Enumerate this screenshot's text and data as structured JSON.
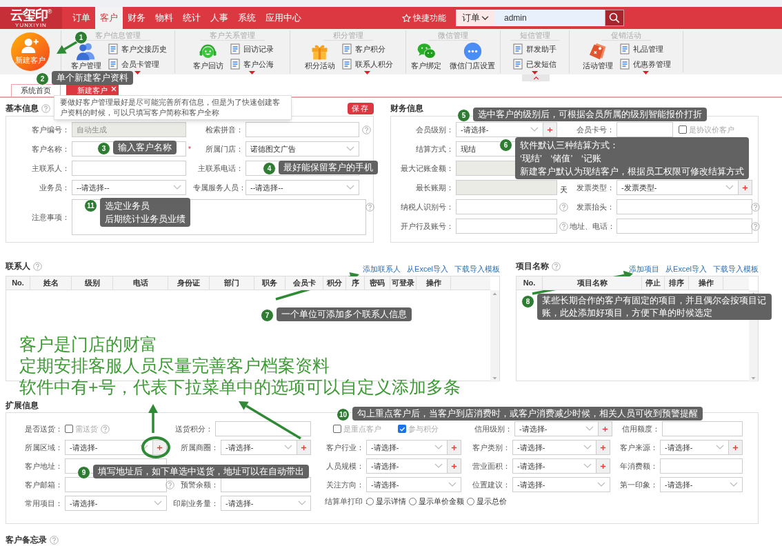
{
  "logo": {
    "name": "云玺印",
    "mark": "®",
    "subtitle": "YUNXIYIN"
  },
  "menu": [
    {
      "label": "订单",
      "selected": false
    },
    {
      "label": "客户",
      "selected": true
    },
    {
      "label": "财务",
      "selected": false
    },
    {
      "label": "物料",
      "selected": false
    },
    {
      "label": "统计",
      "selected": false
    },
    {
      "label": "人事",
      "selected": false
    },
    {
      "label": "系统",
      "selected": false
    },
    {
      "label": "应用中心",
      "selected": false
    }
  ],
  "quick_functions": "快捷功能",
  "search": {
    "scope": "订单",
    "value": "admin"
  },
  "ribbon": {
    "new_customer": "新建客户",
    "groups": [
      {
        "title": "客户信息管理",
        "big": [
          "客户管理"
        ],
        "items": [
          "客户交接历史",
          "会员卡管理"
        ],
        "more": true
      },
      {
        "title": "客户关系管理",
        "big": [
          "客户回访"
        ],
        "items": [
          "回访记录",
          "客户公海"
        ],
        "more": true
      },
      {
        "title": "积分管理",
        "big": [
          "积分活动"
        ],
        "items": [
          "客户积分",
          "联系人积分"
        ],
        "more": true
      },
      {
        "title": "微信管理",
        "big": [
          "客户绑定",
          "微信门店设置"
        ],
        "more": false
      },
      {
        "title": "短信管理",
        "items": [
          "群发助手",
          "已发短信"
        ],
        "more": true
      },
      {
        "title": "促销活动",
        "big": [
          "活动管理"
        ],
        "items": [
          "礼品管理",
          "优惠券管理"
        ],
        "more": true
      }
    ]
  },
  "tabs": [
    {
      "label": "系统首页",
      "selected": false,
      "closable": false
    },
    {
      "label": "新建客户",
      "selected": true,
      "closable": true
    }
  ],
  "tooltip": "要做好客户管理最好是尽可能完善所有信息，但是为了快速创建客户资料的时候，可以只填写客户简称和客户全称",
  "basic": {
    "title": "基本信息",
    "save": "保存",
    "rows": [
      [
        {
          "kind": "input",
          "label": "客户编号：",
          "placeholder": "自动生成",
          "disabled": true
        },
        {
          "kind": "input",
          "label": "检索拼音：",
          "help": true
        }
      ],
      [
        {
          "kind": "input",
          "label": "客户名称：",
          "required_mark": "*"
        },
        {
          "kind": "select",
          "label": "所属门店：",
          "value": "诺德图文广告"
        }
      ],
      [
        {
          "kind": "input",
          "label": "主联系人："
        },
        {
          "kind": "input",
          "label": "主联系电话："
        }
      ],
      [
        {
          "kind": "select",
          "label": "业务员：",
          "value": "--请选择--"
        },
        {
          "kind": "select",
          "label": "专属服务人员：",
          "value": "--请选择--"
        }
      ],
      [
        {
          "kind": "textarea",
          "label": "注意事项：",
          "help": true
        }
      ]
    ]
  },
  "finance": {
    "title": "财务信息",
    "rows": [
      [
        {
          "kind": "select",
          "label": "会员级别：",
          "value": "-请选择-",
          "plus": true
        },
        {
          "kind": "input",
          "label": "会员卡号："
        },
        {
          "kind": "checkbox",
          "text": "是协议价客户",
          "checked": false
        }
      ],
      [
        {
          "kind": "select",
          "label": "结算方式：",
          "value": "现结"
        }
      ],
      [
        {
          "kind": "input",
          "label": "最大记账金额：",
          "disabled": true
        }
      ],
      [
        {
          "kind": "input",
          "label": "最长账期：",
          "disabled": true,
          "suffix": "天"
        },
        {
          "kind": "select",
          "label": "发票类型：",
          "value": "-发票类型-",
          "plus": true
        }
      ],
      [
        {
          "kind": "input",
          "label": "纳税人识别号：",
          "help": true
        },
        {
          "kind": "input",
          "label": "发票抬头：",
          "help": true
        }
      ],
      [
        {
          "kind": "input",
          "label": "开户行及账号：",
          "help": true
        },
        {
          "kind": "input",
          "label": "地址、电话：",
          "help": true
        }
      ]
    ]
  },
  "contacts": {
    "title": "联系人",
    "links": [
      "添加联系人",
      "从Excel导入",
      "下载导入模板"
    ],
    "columns": [
      "No.",
      "姓名",
      "级别",
      "电话",
      "身份证",
      "部门",
      "职务",
      "会员卡",
      "积分",
      "序",
      "密码",
      "可登录",
      "操作"
    ]
  },
  "projects": {
    "title": "项目名称",
    "links": [
      "添加项目",
      "从Excel导入",
      "下载导入模板"
    ],
    "columns": [
      "No.",
      "项目名称",
      "停止",
      "排序",
      "操作"
    ]
  },
  "extended": {
    "title": "扩展信息",
    "left_rows": [
      [
        {
          "kind": "checkbox",
          "label": "是否送货：",
          "text": "需送货",
          "checked": false,
          "help": true
        },
        {
          "kind": "input",
          "label": "送货积分："
        }
      ],
      [
        {
          "kind": "select",
          "label": "所属区域：",
          "value": "-请选择-",
          "plus": true
        },
        {
          "kind": "select",
          "label": "所属商圈：",
          "value": "-请选择-",
          "plus": true
        }
      ],
      [
        {
          "kind": "input",
          "label": "客户地址："
        }
      ],
      [
        {
          "kind": "input",
          "label": "客户邮箱：",
          "help": true
        },
        {
          "kind": "input",
          "label": "预警余额："
        }
      ],
      [
        {
          "kind": "select",
          "label": "常用项目：",
          "value": "-请选择-"
        },
        {
          "kind": "select",
          "label": "印刷业务量：",
          "value": "-请选择-"
        }
      ]
    ],
    "right_rows": [
      [
        {
          "kind": "checks",
          "items": [
            {
              "text": "是重点客户",
              "checked": false
            },
            {
              "text": "参与积分",
              "checked": true
            }
          ]
        },
        {
          "kind": "select",
          "label": "信用级别：",
          "value": "-请选择-",
          "plus": true
        },
        {
          "kind": "input",
          "label": "信用额度："
        }
      ],
      [
        {
          "kind": "select",
          "label": "客户行业：",
          "value": "-请选择-",
          "plus": true
        },
        {
          "kind": "select",
          "label": "客户类别：",
          "value": "-请选择-",
          "plus": true
        },
        {
          "kind": "select",
          "label": "客户来源：",
          "value": "-请选择-",
          "plus": true
        }
      ],
      [
        {
          "kind": "select",
          "label": "人员规模：",
          "value": "-请选择-",
          "plus": true
        },
        {
          "kind": "select",
          "label": "营业面积：",
          "value": "-请选择-",
          "plus": true
        },
        {
          "kind": "input",
          "label": "年消费额："
        }
      ],
      [
        {
          "kind": "select",
          "label": "关注方向：",
          "value": "-请选择-"
        },
        {
          "kind": "select",
          "label": "位置建议：",
          "value": "-请选择-"
        },
        {
          "kind": "select",
          "label": "第一印象：",
          "value": "-请选择-"
        }
      ],
      [
        {
          "kind": "radios",
          "label": "结算单打印：",
          "options": [
            {
              "text": "显示详情",
              "selected": false
            },
            {
              "text": "显示单价金额",
              "selected": false
            },
            {
              "text": "显示总价",
              "selected": false
            }
          ]
        }
      ]
    ]
  },
  "memo": {
    "title": "客户备忘录"
  },
  "callouts": [
    {
      "number": "1"
    },
    {
      "number": "2",
      "text": "单个新建客户资料"
    },
    {
      "number": "3",
      "text": "输入客户名称"
    },
    {
      "number": "4",
      "text": "最好能保留客户的手机"
    },
    {
      "number": "5",
      "text": "选中客户的级别后，可根据会员所属的级别智能报价打折"
    },
    {
      "number": "6",
      "lines": [
        "软件默认三种结算方式：",
        "‘现结’　‘储值’　‘记账",
        "新建客户默认为现结客户，根据员工权限可修改结算方式"
      ]
    },
    {
      "number": "7",
      "text": "一个单位可添加多个联系人信息"
    },
    {
      "number": "8",
      "text": "某些长期合作的客户有固定的项目，并且偶尔会按项目记账，此处添加好项目，方便下单的时候选定"
    },
    {
      "number": "9",
      "text": "填写地址后，如下单选中送货，地址可以在自动带出"
    },
    {
      "number": "10",
      "text": "勾上重点客户后，当客户到店消费时，或客户消费减少时候，相关人员可收到预警提醒"
    },
    {
      "number": "11",
      "lines": [
        "选定业务员",
        "后期统计业务员业绩"
      ]
    }
  ],
  "notes": [
    "客户是门店的财富",
    "定期安排客服人员尽量完善客户档案资料",
    "软件中有+号，代表下拉菜单中的选项可以自定义添加多条"
  ]
}
